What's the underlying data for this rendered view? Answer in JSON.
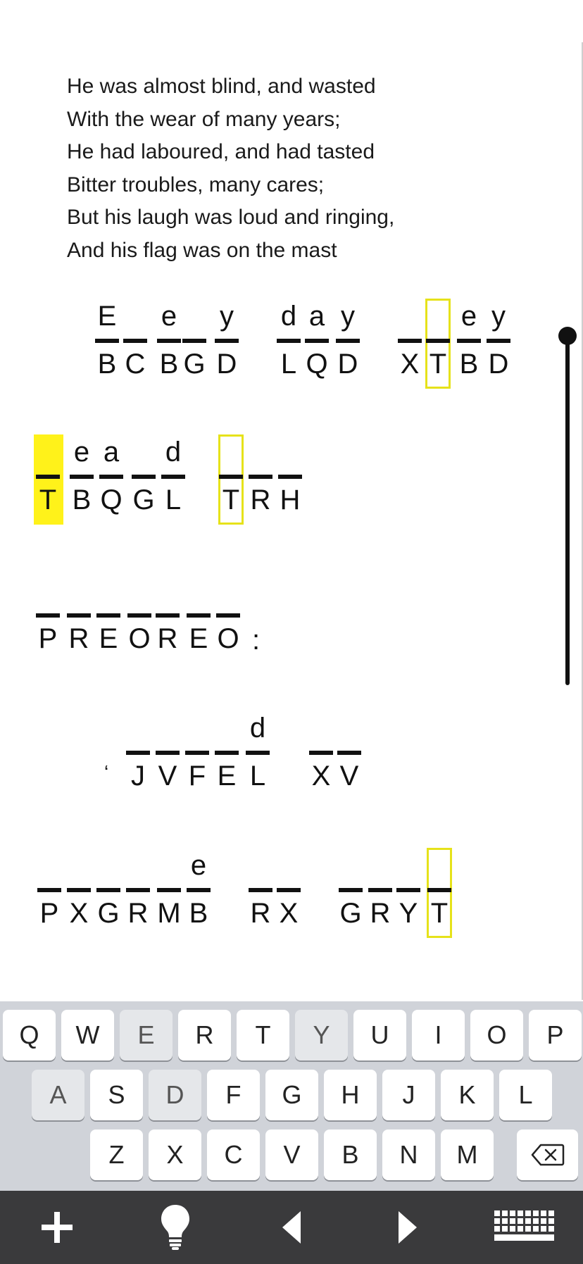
{
  "poem": {
    "lines": [
      "He was almost blind, and wasted",
      "With the wear of many years;",
      "He had laboured, and had tasted",
      "Bitter troubles, many cares;",
      "But his laugh was loud and ringing,",
      "And his flag was on the mast"
    ]
  },
  "puzzle": {
    "rows": [
      {
        "cells": [
          {
            "cipher": "B",
            "guess": "E"
          },
          {
            "cipher": "C",
            "guess": ""
          },
          {
            "cipher": "B",
            "guess": "e"
          },
          {
            "cipher": "G",
            "guess": ""
          },
          {
            "cipher": "D",
            "guess": "y"
          },
          {
            "cipher": "L",
            "guess": "d"
          },
          {
            "cipher": "Q",
            "guess": "a"
          },
          {
            "cipher": "D",
            "guess": "y"
          },
          {
            "cipher": "X",
            "guess": ""
          },
          {
            "cipher": "T",
            "guess": "",
            "highlight": "box"
          },
          {
            "cipher": "B",
            "guess": "e"
          },
          {
            "cipher": "D",
            "guess": "y"
          }
        ]
      },
      {
        "cells": [
          {
            "cipher": "T",
            "guess": "",
            "highlight": "active"
          },
          {
            "cipher": "B",
            "guess": "e"
          },
          {
            "cipher": "Q",
            "guess": "a"
          },
          {
            "cipher": "G",
            "guess": ""
          },
          {
            "cipher": "L",
            "guess": "d"
          },
          {
            "cipher": "T",
            "guess": "",
            "highlight": "box"
          },
          {
            "cipher": "R",
            "guess": ""
          },
          {
            "cipher": "H",
            "guess": ""
          }
        ]
      },
      {
        "cells": [
          {
            "cipher": "P",
            "guess": ""
          },
          {
            "cipher": "R",
            "guess": ""
          },
          {
            "cipher": "E",
            "guess": ""
          },
          {
            "cipher": "O",
            "guess": ""
          },
          {
            "cipher": "R",
            "guess": ""
          },
          {
            "cipher": "E",
            "guess": ""
          },
          {
            "cipher": "O",
            "guess": ""
          }
        ],
        "punctuation": ":"
      },
      {
        "leading_punctuation": "‘",
        "cells": [
          {
            "cipher": "J",
            "guess": ""
          },
          {
            "cipher": "V",
            "guess": ""
          },
          {
            "cipher": "F",
            "guess": ""
          },
          {
            "cipher": "E",
            "guess": ""
          },
          {
            "cipher": "L",
            "guess": "d"
          },
          {
            "cipher": "X",
            "guess": ""
          },
          {
            "cipher": "V",
            "guess": ""
          }
        ]
      },
      {
        "cells": [
          {
            "cipher": "P",
            "guess": ""
          },
          {
            "cipher": "X",
            "guess": ""
          },
          {
            "cipher": "G",
            "guess": ""
          },
          {
            "cipher": "R",
            "guess": ""
          },
          {
            "cipher": "M",
            "guess": ""
          },
          {
            "cipher": "B",
            "guess": "e"
          },
          {
            "cipher": "R",
            "guess": ""
          },
          {
            "cipher": "X",
            "guess": ""
          },
          {
            "cipher": "G",
            "guess": ""
          },
          {
            "cipher": "R",
            "guess": ""
          },
          {
            "cipher": "Y",
            "guess": ""
          },
          {
            "cipher": "T",
            "guess": "",
            "highlight": "box"
          }
        ]
      }
    ]
  },
  "keyboard": {
    "rows": [
      [
        "Q",
        "W",
        "E",
        "R",
        "T",
        "Y",
        "U",
        "I",
        "O",
        "P"
      ],
      [
        "A",
        "S",
        "D",
        "F",
        "G",
        "H",
        "J",
        "K",
        "L"
      ],
      [
        "Z",
        "X",
        "C",
        "V",
        "B",
        "N",
        "M"
      ]
    ],
    "used_keys": [
      "E",
      "Y",
      "A",
      "D"
    ],
    "delete_icon": "backspace-icon"
  },
  "toolbar": {
    "icons": [
      "plus-icon",
      "lightbulb-icon",
      "arrow-left-icon",
      "arrow-right-icon",
      "keyboard-icon"
    ]
  },
  "colors": {
    "highlight": "#fff21a",
    "highlight_border": "#e6e21a",
    "keyboard_bg": "#d0d3d9",
    "toolbar_bg": "#3a3a3c"
  }
}
